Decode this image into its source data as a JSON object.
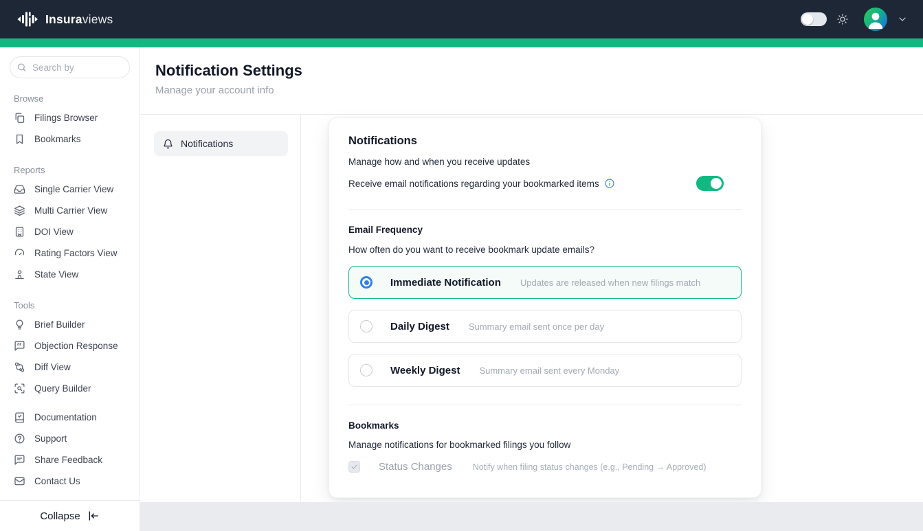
{
  "topbar": {
    "brand_bold": "Insura",
    "brand_light": "views",
    "theme_toggle_on": false
  },
  "sidebar": {
    "search_placeholder": "Search by",
    "sections": [
      {
        "label": "Browse",
        "items": [
          {
            "icon": "copy",
            "label": "Filings Browser"
          },
          {
            "icon": "bookmark",
            "label": "Bookmarks"
          }
        ]
      },
      {
        "label": "Reports",
        "items": [
          {
            "icon": "inbox",
            "label": "Single Carrier View"
          },
          {
            "icon": "layers",
            "label": "Multi Carrier View"
          },
          {
            "icon": "building",
            "label": "DOI View"
          },
          {
            "icon": "gauge",
            "label": "Rating Factors View"
          },
          {
            "icon": "person-map",
            "label": "State View"
          }
        ]
      },
      {
        "label": "Tools",
        "items": [
          {
            "icon": "lightbulb",
            "label": "Brief Builder"
          },
          {
            "icon": "message-quote",
            "label": "Objection Response"
          },
          {
            "icon": "git-compare",
            "label": "Diff View"
          },
          {
            "icon": "scan-search",
            "label": "Query Builder"
          }
        ]
      }
    ],
    "footer_items": [
      {
        "icon": "book-check",
        "label": "Documentation"
      },
      {
        "icon": "help-circle",
        "label": "Support"
      },
      {
        "icon": "message-square",
        "label": "Share Feedback"
      },
      {
        "icon": "mail",
        "label": "Contact Us"
      }
    ],
    "collapse_label": "Collapse"
  },
  "page": {
    "title": "Notification Settings",
    "subtitle": "Manage your account info"
  },
  "settings_nav": [
    {
      "icon": "bell",
      "label": "Notifications",
      "active": true
    }
  ],
  "card": {
    "title": "Notifications",
    "description": "Manage how and when you receive updates",
    "email_toggle": {
      "label": "Receive email notifications regarding your bookmarked items",
      "enabled": true
    },
    "email_frequency": {
      "title": "Email Frequency",
      "question": "How often do you want to receive bookmark update emails?",
      "options": [
        {
          "label": "Immediate Notification",
          "description": "Updates are released when new filings match",
          "selected": true
        },
        {
          "label": "Daily Digest",
          "description": "Summary email sent once per day",
          "selected": false
        },
        {
          "label": "Weekly Digest",
          "description": "Summary email sent every Monday",
          "selected": false
        }
      ]
    },
    "bookmarks": {
      "title": "Bookmarks",
      "description": "Manage notifications for bookmarked filings you follow",
      "options": [
        {
          "label": "Status Changes",
          "description": "Notify when filing status changes (e.g., Pending → Approved)",
          "checked": true,
          "disabled": true
        }
      ]
    }
  },
  "colors": {
    "topbar_bg": "#1e2736",
    "accent_green": "#10b981",
    "radio_blue": "#2f80ed",
    "info_blue": "#3b82f6"
  }
}
